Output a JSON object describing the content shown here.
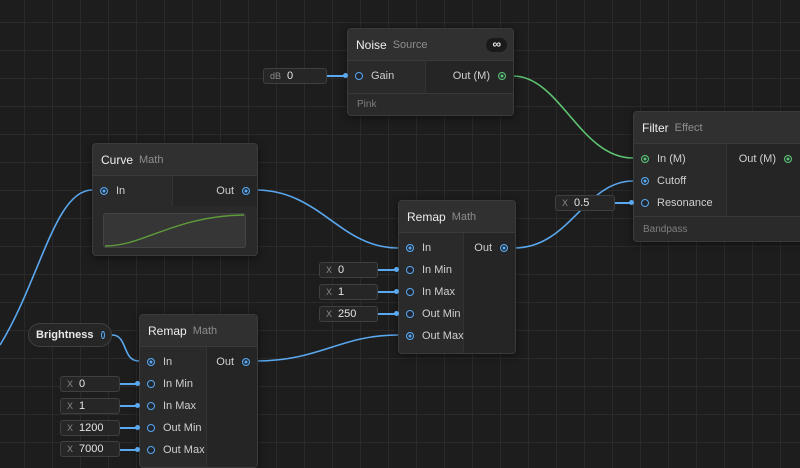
{
  "noise": {
    "title": "Noise",
    "subtitle": "Source",
    "badge": "∞",
    "input": "Gain",
    "output": "Out (M)",
    "footer": "Pink",
    "gain_prefix": "dB",
    "gain_value": "0"
  },
  "filter": {
    "title": "Filter",
    "subtitle": "Effect",
    "inputs": [
      "In (M)",
      "Cutoff",
      "Resonance"
    ],
    "output": "Out (M)",
    "footer": "Bandpass",
    "resonance_prefix": "X",
    "resonance_value": "0.5"
  },
  "curve": {
    "title": "Curve",
    "subtitle": "Math",
    "input": "In",
    "output": "Out"
  },
  "remap1": {
    "title": "Remap",
    "subtitle": "Math",
    "inputs": [
      "In",
      "In Min",
      "In Max",
      "Out Min",
      "Out Max"
    ],
    "output": "Out",
    "fields": [
      {
        "prefix": "X",
        "value": "0"
      },
      {
        "prefix": "X",
        "value": "1"
      },
      {
        "prefix": "X",
        "value": "250"
      }
    ]
  },
  "remap2": {
    "title": "Remap",
    "subtitle": "Math",
    "inputs": [
      "In",
      "In Min",
      "In Max",
      "Out Min",
      "Out Max"
    ],
    "output": "Out",
    "fields": [
      {
        "prefix": "X",
        "value": "0"
      },
      {
        "prefix": "X",
        "value": "1"
      },
      {
        "prefix": "X",
        "value": "1200"
      },
      {
        "prefix": "X",
        "value": "7000"
      }
    ]
  },
  "brightness": {
    "label": "Brightness"
  },
  "colors": {
    "signal": "#5aa8f0",
    "audio": "#5ec472",
    "curve": "#5e9a3a",
    "background": "#1d1d1d"
  }
}
